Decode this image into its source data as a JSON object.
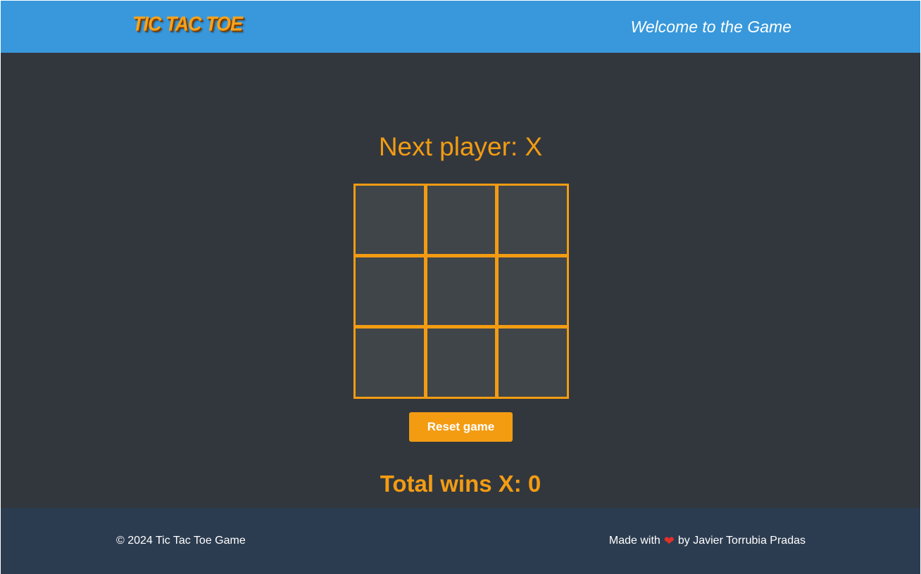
{
  "header": {
    "logo_text": "TIC TAC TOE",
    "welcome_text": "Welcome to the Game"
  },
  "game": {
    "status_text": "Next player: X",
    "board": [
      "",
      "",
      "",
      "",
      "",
      "",
      "",
      "",
      ""
    ],
    "reset_label": "Reset game",
    "total_wins_text": "Total wins X: 0"
  },
  "footer": {
    "copyright_text": "© 2024 Tic Tac Toe Game",
    "made_with_text": "Made with",
    "heart_icon": "heart-icon",
    "author_text": "by Javier Torrubia Pradas"
  },
  "colors": {
    "header_bg": "#3898db",
    "stage_bg": "#32373e",
    "accent": "#f39c12",
    "cell_bg": "#40454a",
    "footer_bg": "#2c3c50"
  }
}
